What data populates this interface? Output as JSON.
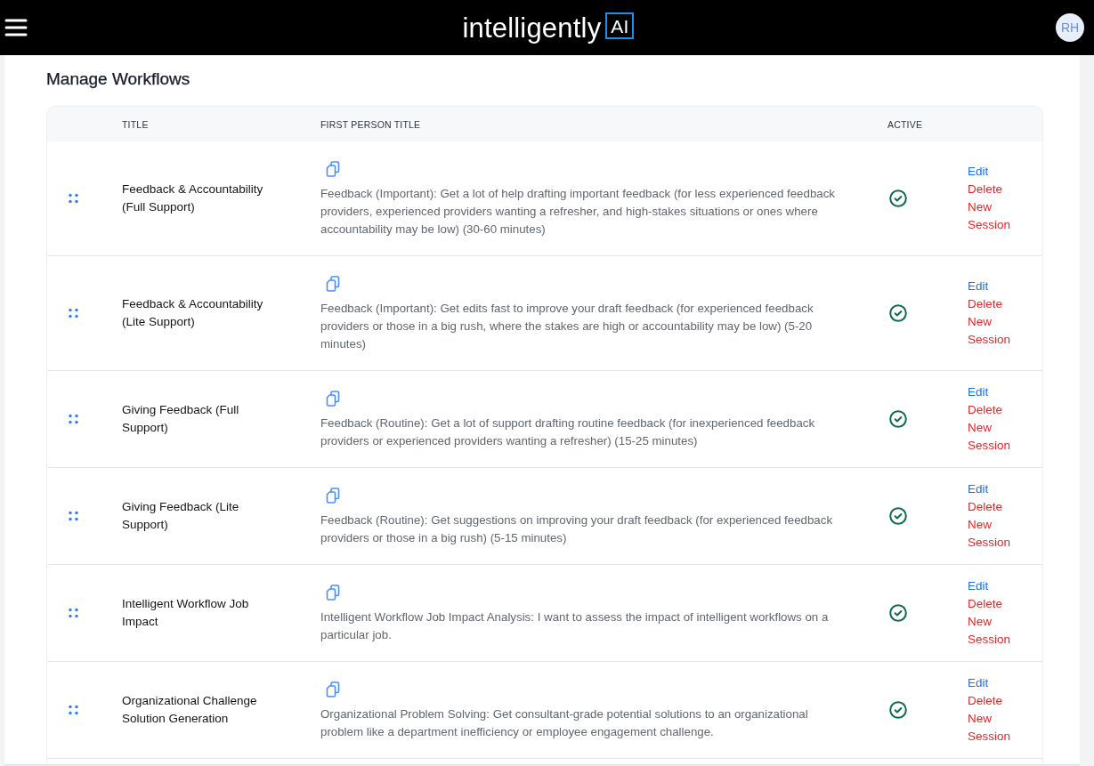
{
  "header": {
    "logo": {
      "text": "intelligently",
      "mark": "AI"
    },
    "avatar": {
      "initials": "RH"
    }
  },
  "page": {
    "title": "Manage Workflows"
  },
  "table": {
    "columns": [
      "TITLE",
      "FIRST PERSON TITLE",
      "ACTIVE"
    ],
    "rows": [
      {
        "title": "Feedback & Accountability (Full Support)",
        "first_person_title": "Feedback (Important): Get a lot of help drafting important feedback (for less experienced feedback providers, experienced providers wanting a refresher, and high-stakes situations or ones where accountability may be low) (30-60 minutes)",
        "active": true,
        "actions": [
          {
            "label": "Edit",
            "kind": "edit"
          },
          {
            "label": "Delete",
            "kind": "delete"
          },
          {
            "label": "New Session",
            "kind": "new-session"
          }
        ]
      },
      {
        "title": "Feedback & Accountability (Lite Support)",
        "first_person_title": "Feedback (Important): Get edits fast to improve your draft feedback (for experienced feedback providers or those in a big rush, where the stakes are high or accountability may be low) (5-20 minutes)",
        "active": true,
        "actions": [
          {
            "label": "Edit",
            "kind": "edit"
          },
          {
            "label": "Delete",
            "kind": "delete"
          },
          {
            "label": "New Session",
            "kind": "new-session"
          }
        ]
      },
      {
        "title": "Giving Feedback (Full Support)",
        "first_person_title": "Feedback (Routine): Get a lot of support drafting routine feedback (for inexperienced feedback providers or experienced providers wanting a refresher) (15-25 minutes)",
        "active": true,
        "actions": [
          {
            "label": "Edit",
            "kind": "edit"
          },
          {
            "label": "Delete",
            "kind": "delete"
          },
          {
            "label": "New Session",
            "kind": "new-session"
          }
        ]
      },
      {
        "title": "Giving Feedback (Lite Support)",
        "first_person_title": "Feedback (Routine): Get suggestions on improving your draft feedback (for experienced feedback providers or those in a big rush) (5-15 minutes)",
        "active": true,
        "actions": [
          {
            "label": "Edit",
            "kind": "edit"
          },
          {
            "label": "Delete",
            "kind": "delete"
          },
          {
            "label": "New Session",
            "kind": "new-session"
          }
        ]
      },
      {
        "title": "Intelligent Workflow Job Impact",
        "first_person_title": "Intelligent Workflow Job Impact Analysis: I want to assess the impact of intelligent workflows on a particular job.",
        "active": true,
        "actions": [
          {
            "label": "Edit",
            "kind": "edit"
          },
          {
            "label": "Delete",
            "kind": "delete"
          },
          {
            "label": "New Session",
            "kind": "new-session"
          }
        ]
      },
      {
        "title": "Organizational Challenge Solution Generation",
        "first_person_title": "Organizational Problem Solving: Get consultant-grade potential solutions to an organizational problem like a department inefficiency or employee engagement challenge.",
        "active": true,
        "actions": [
          {
            "label": "Edit",
            "kind": "edit"
          },
          {
            "label": "Delete",
            "kind": "delete"
          },
          {
            "label": "New Session",
            "kind": "new-session"
          }
        ]
      }
    ]
  }
}
